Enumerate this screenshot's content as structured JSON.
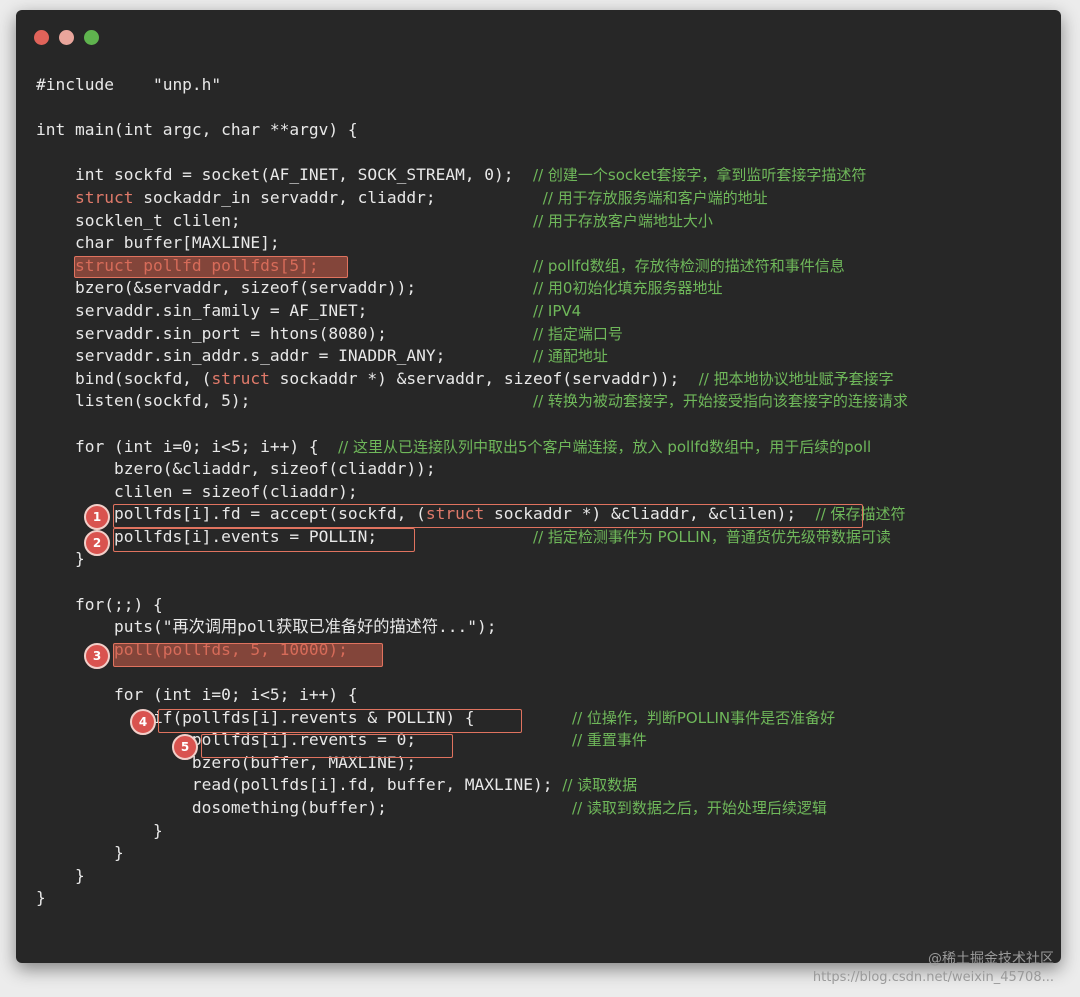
{
  "window": {
    "traffic_lights": [
      {
        "name": "close",
        "color": "#e0635a"
      },
      {
        "name": "minimize",
        "color": "#e9a59c"
      },
      {
        "name": "zoom",
        "color": "#5fb34e"
      }
    ]
  },
  "code_lines": [
    [
      {
        "t": "#include    \"unp.h\"",
        "c": "kw"
      }
    ],
    [],
    [
      {
        "t": "int main(int argc, char **argv) {",
        "c": "kw"
      }
    ],
    [],
    [
      {
        "t": "    int sockfd = socket(AF_INET, SOCK_STREAM, 0);  ",
        "c": "kw"
      },
      {
        "t": "// 创建一个socket套接字，拿到监听套接字描述符",
        "c": "cmt"
      }
    ],
    [
      {
        "t": "    struct",
        "c": "type"
      },
      {
        "t": " sockaddr_in servaddr, cliaddr;           ",
        "c": "kw"
      },
      {
        "t": "// 用于存放服务端和客户端的地址",
        "c": "cmt"
      }
    ],
    [
      {
        "t": "    socklen_t clilen;                              ",
        "c": "kw"
      },
      {
        "t": "// 用于存放客户端地址大小",
        "c": "cmt"
      }
    ],
    [
      {
        "t": "    char buffer[MAXLINE];",
        "c": "kw"
      }
    ],
    [
      {
        "t": "    struct pollfd pollfds[5];                      ",
        "c": "type"
      },
      {
        "t": "// pollfd数组，存放待检测的描述符和事件信息",
        "c": "cmt"
      }
    ],
    [
      {
        "t": "    bzero(&servaddr, sizeof(servaddr));            ",
        "c": "kw"
      },
      {
        "t": "// 用0初始化填充服务器地址",
        "c": "cmt"
      }
    ],
    [
      {
        "t": "    servaddr.sin_family = AF_INET;                 ",
        "c": "kw"
      },
      {
        "t": "// IPV4",
        "c": "cmt"
      }
    ],
    [
      {
        "t": "    servaddr.sin_port = htons(8080);               ",
        "c": "kw"
      },
      {
        "t": "// 指定端口号",
        "c": "cmt"
      }
    ],
    [
      {
        "t": "    servaddr.sin_addr.s_addr = INADDR_ANY;         ",
        "c": "kw"
      },
      {
        "t": "// 通配地址",
        "c": "cmt"
      }
    ],
    [
      {
        "t": "    bind(sockfd, (",
        "c": "kw"
      },
      {
        "t": "struct",
        "c": "type"
      },
      {
        "t": " sockaddr *) &servaddr, sizeof(servaddr));  ",
        "c": "kw"
      },
      {
        "t": "// 把本地协议地址赋予套接字",
        "c": "cmt"
      }
    ],
    [
      {
        "t": "    listen(sockfd, 5);                             ",
        "c": "kw"
      },
      {
        "t": "// 转换为被动套接字，开始接受指向该套接字的连接请求",
        "c": "cmt"
      }
    ],
    [],
    [
      {
        "t": "    for (int i=0; i<5; i++) {  ",
        "c": "kw"
      },
      {
        "t": "// 这里从已连接队列中取出5个客户端连接，放入 pollfd数组中，用于后续的poll",
        "c": "cmt"
      }
    ],
    [
      {
        "t": "        bzero(&cliaddr, sizeof(cliaddr));",
        "c": "kw"
      }
    ],
    [
      {
        "t": "        clilen = sizeof(cliaddr);",
        "c": "kw"
      }
    ],
    [
      {
        "t": "        pollfds[i].fd = accept(sockfd, (",
        "c": "kw"
      },
      {
        "t": "struct",
        "c": "type"
      },
      {
        "t": " sockaddr *) &cliaddr, &clilen);  ",
        "c": "kw"
      },
      {
        "t": "// 保存描述符",
        "c": "cmt"
      }
    ],
    [
      {
        "t": "        pollfds[i].events = POLLIN;                ",
        "c": "kw"
      },
      {
        "t": "// 指定检测事件为 POLLIN，普通货优先级带数据可读",
        "c": "cmt"
      }
    ],
    [
      {
        "t": "    }",
        "c": "kw"
      }
    ],
    [],
    [
      {
        "t": "    for(;;) {",
        "c": "kw"
      }
    ],
    [
      {
        "t": "        puts(\"再次调用poll获取已准备好的描述符...\");",
        "c": "kw"
      }
    ],
    [
      {
        "t": "        poll(pollfds, 5, 10000);",
        "c": "type"
      }
    ],
    [],
    [
      {
        "t": "        for (int i=0; i<5; i++) {",
        "c": "kw"
      }
    ],
    [
      {
        "t": "            if(pollfds[i].revents & POLLIN) {          ",
        "c": "kw"
      },
      {
        "t": "// 位操作，判断POLLIN事件是否准备好",
        "c": "cmt"
      }
    ],
    [
      {
        "t": "                pollfds[i].revents = 0;                ",
        "c": "kw"
      },
      {
        "t": "// 重置事件",
        "c": "cmt"
      }
    ],
    [
      {
        "t": "                bzero(buffer, MAXLINE);",
        "c": "kw"
      }
    ],
    [
      {
        "t": "                read(pollfds[i].fd, buffer, MAXLINE); ",
        "c": "kw"
      },
      {
        "t": "// 读取数据",
        "c": "cmt"
      }
    ],
    [
      {
        "t": "                dosomething(buffer);                   ",
        "c": "kw"
      },
      {
        "t": "// 读取到数据之后，开始处理后续逻辑",
        "c": "cmt"
      }
    ],
    [
      {
        "t": "            }",
        "c": "kw"
      }
    ],
    [
      {
        "t": "        }",
        "c": "kw"
      }
    ],
    [
      {
        "t": "    }",
        "c": "kw"
      }
    ],
    [
      {
        "t": "}",
        "c": "kw"
      }
    ]
  ],
  "badges": [
    "1",
    "2",
    "3",
    "4",
    "5"
  ],
  "watermark": {
    "line1": "@稀土掘金技术社区",
    "line2": "https://blog.csdn.net/weixin_45708..."
  }
}
